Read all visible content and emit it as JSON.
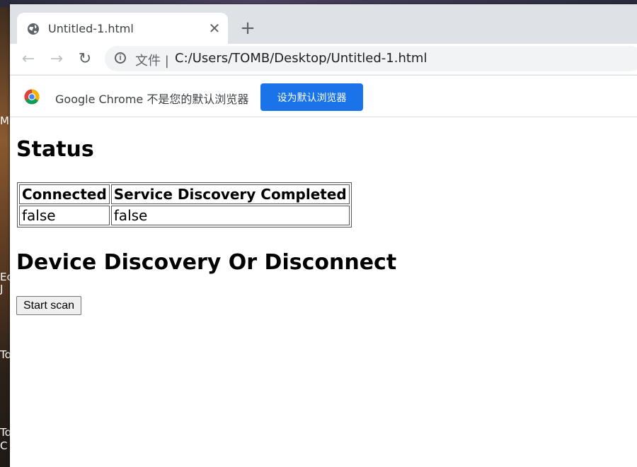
{
  "desktop": {
    "labels": [
      "M",
      "Ec",
      "J",
      "To",
      "To",
      "C"
    ]
  },
  "browser": {
    "tab": {
      "title": "Untitled-1.html",
      "close": "✕"
    },
    "new_tab": "+",
    "nav": {
      "back": "←",
      "forward": "→",
      "reload": "↻"
    },
    "omnibox": {
      "chip": "文件 |",
      "url": "C:/Users/TOMB/Desktop/Untitled-1.html"
    },
    "infobar": {
      "text": "Google Chrome 不是您的默认浏览器",
      "button": "设为默认浏览器"
    }
  },
  "page": {
    "status_heading": "Status",
    "table": {
      "headers": [
        "Connected",
        "Service Discovery Completed"
      ],
      "rows": [
        [
          "false",
          "false"
        ]
      ]
    },
    "device_heading": "Device Discovery Or Disconnect",
    "scan_button": "Start scan"
  },
  "colors": {
    "accent": "#1a73e8",
    "tabstrip": "#dee1e6"
  }
}
